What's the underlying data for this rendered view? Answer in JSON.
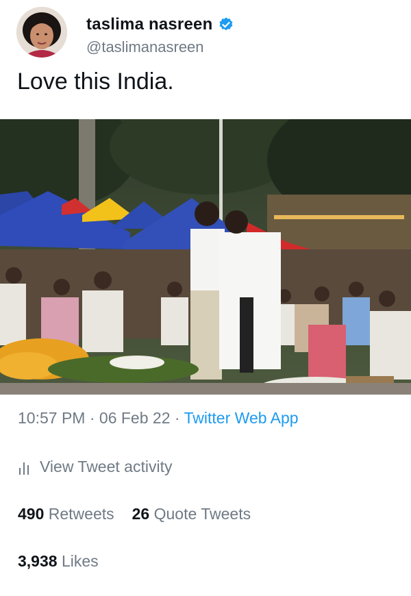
{
  "author": {
    "display_name": "taslima nasreen",
    "handle": "@taslimanasreen",
    "verified": true
  },
  "tweet": {
    "text": "Love this India."
  },
  "media": {
    "description_icon": "photo"
  },
  "meta": {
    "time": "10:57 PM",
    "separator1": " · ",
    "date": "06 Feb 22",
    "separator2": " · ",
    "source": "Twitter Web App"
  },
  "activity": {
    "label": "View Tweet activity"
  },
  "stats": {
    "retweets_count": "490",
    "retweets_label": "Retweets",
    "quotes_count": "26",
    "quotes_label": "Quote Tweets",
    "likes_count": "3,938",
    "likes_label": "Likes"
  },
  "colors": {
    "accent": "#1d9bf0",
    "secondary_text": "#6f7a85",
    "primary_text": "#0f1419"
  }
}
